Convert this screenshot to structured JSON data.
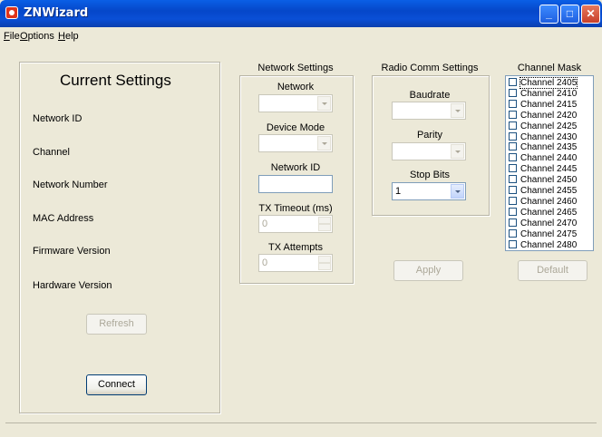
{
  "window": {
    "title": "ZNWizard"
  },
  "menu": [
    {
      "label": "File"
    },
    {
      "label": "Options"
    },
    {
      "label": "Help"
    }
  ],
  "current_settings": {
    "title": "Current Settings",
    "labels": [
      "Network ID",
      "Channel",
      "Network Number",
      "MAC Address",
      "Firmware Version",
      "Hardware Version"
    ],
    "refresh_label": "Refresh",
    "connect_label": "Connect"
  },
  "network_settings": {
    "title": "Network Settings",
    "network_label": "Network",
    "device_mode_label": "Device Mode",
    "network_id_label": "Network ID",
    "network_id_value": "",
    "tx_timeout_label": "TX Timeout (ms)",
    "tx_timeout_value": "0",
    "tx_attempts_label": "TX Attempts",
    "tx_attempts_value": "0"
  },
  "radio_comm": {
    "title": "Radio Comm Settings",
    "baudrate_label": "Baudrate",
    "parity_label": "Parity",
    "stop_bits_label": "Stop Bits",
    "stop_bits_value": "1",
    "apply_label": "Apply"
  },
  "channel_mask": {
    "title": "Channel Mask",
    "channels": [
      "Channel 2405",
      "Channel 2410",
      "Channel 2415",
      "Channel 2420",
      "Channel 2425",
      "Channel 2430",
      "Channel 2435",
      "Channel 2440",
      "Channel 2445",
      "Channel 2450",
      "Channel 2455",
      "Channel 2460",
      "Channel 2465",
      "Channel 2470",
      "Channel 2475",
      "Channel 2480"
    ],
    "default_label": "Default"
  }
}
